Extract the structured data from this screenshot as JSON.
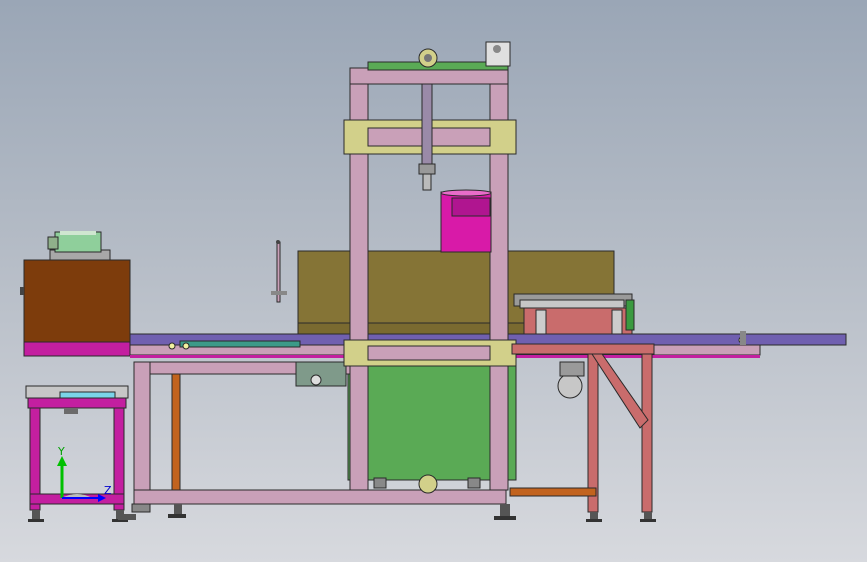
{
  "viewport": {
    "background_top": "#9aa6b6",
    "background_bottom": "#d7d9de"
  },
  "triad": {
    "y_label": "Y",
    "z_label": "Z",
    "y_color": "#00c000",
    "z_color": "#0000ff"
  },
  "colors": {
    "frame_pink": "#c9a0b8",
    "magenta_frame": "#c31fa0",
    "yellow_beam": "#d2d08a",
    "olive_oven": "#857436",
    "brown_box": "#7d3c0c",
    "green_box": "#5aaa55",
    "magenta_bucket": "#d81aa8",
    "orange_leg": "#c2631e",
    "conveyor_blue": "#7060b0"
  }
}
